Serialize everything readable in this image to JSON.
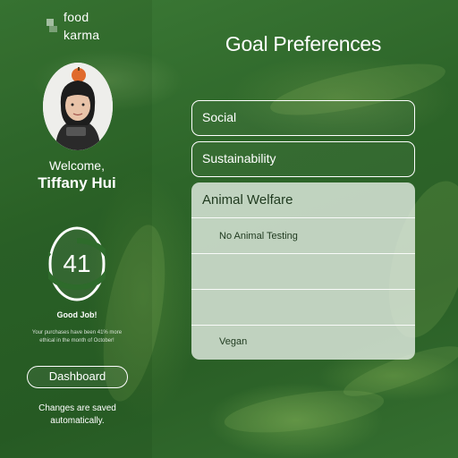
{
  "app": {
    "logo_line1": "food",
    "logo_line2": "karma"
  },
  "user": {
    "welcome_label": "Welcome,",
    "name": "Tiffany Hui"
  },
  "score": {
    "value": "41",
    "progress_fraction": 0.82,
    "headline": "Good Job!",
    "message": "Your purchases have been 41% more ethical in the month of October!"
  },
  "sidebar": {
    "dashboard_label": "Dashboard",
    "saved_note": "Changes are saved automatically."
  },
  "main": {
    "title": "Goal Preferences",
    "goals": [
      {
        "label": "Social"
      },
      {
        "label": "Sustainability"
      }
    ],
    "expanded_goal": {
      "label": "Animal Welfare",
      "options": [
        {
          "label": "No Animal Testing"
        },
        {
          "label": ""
        },
        {
          "label": ""
        },
        {
          "label": "Vegan"
        }
      ]
    }
  },
  "colors": {
    "background": "#2f6a2c",
    "ring_track": "#ffffff",
    "ring_fill": "#2e6b2b",
    "text": "#ffffff"
  }
}
